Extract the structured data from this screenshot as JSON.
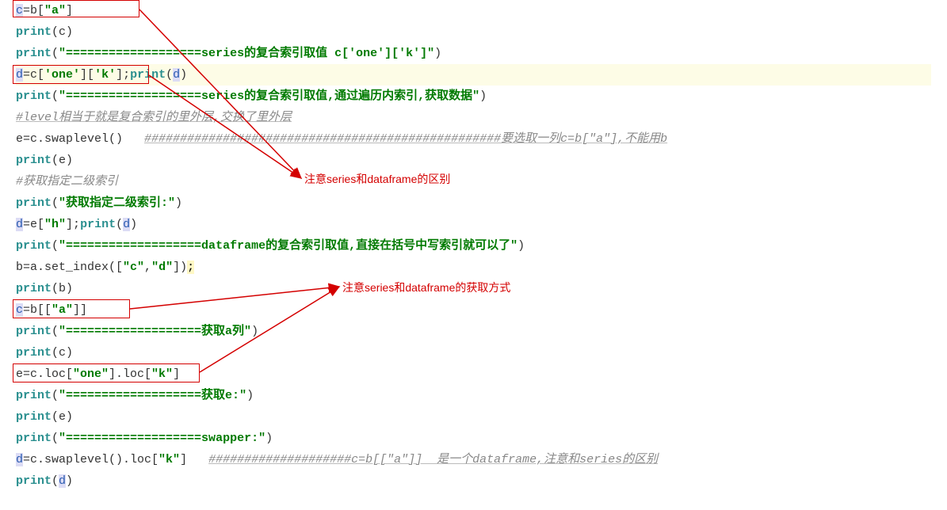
{
  "lines": {
    "l1_a": "c",
    "l1_b": "=b[",
    "l1_c": "\"a\"",
    "l1_d": "]",
    "l2_a": "print",
    "l2_b": "(c)",
    "l3_a": "print",
    "l3_b": "(",
    "l3_c": "\"===================series的复合索引取值 c['one']['k']\"",
    "l3_d": ")",
    "l4_a": "d",
    "l4_b": "=c[",
    "l4_c": "'one'",
    "l4_d": "][",
    "l4_e": "'k'",
    "l4_f": "];",
    "l4_g": "print",
    "l4_h": "(",
    "l4_i": "d",
    "l4_j": ")",
    "l5_a": "print",
    "l5_b": "(",
    "l5_c": "\"===================series的复合索引取值,通过遍历内索引,获取数据\"",
    "l5_d": ")",
    "l6": "#level相当于就是复合索引的里外层,交换了里外层",
    "l7_a": "e=c.swaplevel()   ",
    "l7_b": "##################################################要选取一列c=b[\"a\"],不能用b",
    "l8_a": "print",
    "l8_b": "(e)",
    "l9": "#获取指定二级索引",
    "l10_a": "print",
    "l10_b": "(",
    "l10_c": "\"获取指定二级索引:\"",
    "l10_d": ")",
    "l11_a": "d",
    "l11_b": "=e[",
    "l11_c": "\"h\"",
    "l11_d": "];",
    "l11_e": "print",
    "l11_f": "(",
    "l11_g": "d",
    "l11_h": ")",
    "l12_a": "print",
    "l12_b": "(",
    "l12_c": "\"===================dataframe的复合索引取值,直接在括号中写索引就可以了\"",
    "l12_d": ")",
    "l13_a": "b=a.set_index([",
    "l13_b": "\"c\"",
    "l13_c": ",",
    "l13_d": "\"d\"",
    "l13_e": "])",
    "l13_f": ";",
    "l14_a": "print",
    "l14_b": "(b)",
    "l15_a": "c",
    "l15_b": "=b[[",
    "l15_c": "\"a\"",
    "l15_d": "]]",
    "l16_a": "print",
    "l16_b": "(",
    "l16_c": "\"===================获取a列\"",
    "l16_d": ")",
    "l17_a": "print",
    "l17_b": "(c)",
    "l18_a": "e=c.loc[",
    "l18_b": "\"one\"",
    "l18_c": "].loc[",
    "l18_d": "\"k\"",
    "l18_e": "]",
    "l19_a": "print",
    "l19_b": "(",
    "l19_c": "\"===================获取e:\"",
    "l19_d": ")",
    "l20_a": "print",
    "l20_b": "(e)",
    "l21_a": "print",
    "l21_b": "(",
    "l21_c": "\"===================swapper:\"",
    "l21_d": ")",
    "l22_a": "d",
    "l22_b": "=c.swaplevel().loc[",
    "l22_c": "\"k\"",
    "l22_d": "]   ",
    "l22_e": "####################c=b[[\"a\"]]  是一个dataframe,注意和series的区别",
    "l23_a": "print",
    "l23_b": "(",
    "l23_c": "d",
    "l23_d": ")"
  },
  "annotations": {
    "note1": "注意series和dataframe的区别",
    "note2": "注意series和dataframe的获取方式"
  }
}
